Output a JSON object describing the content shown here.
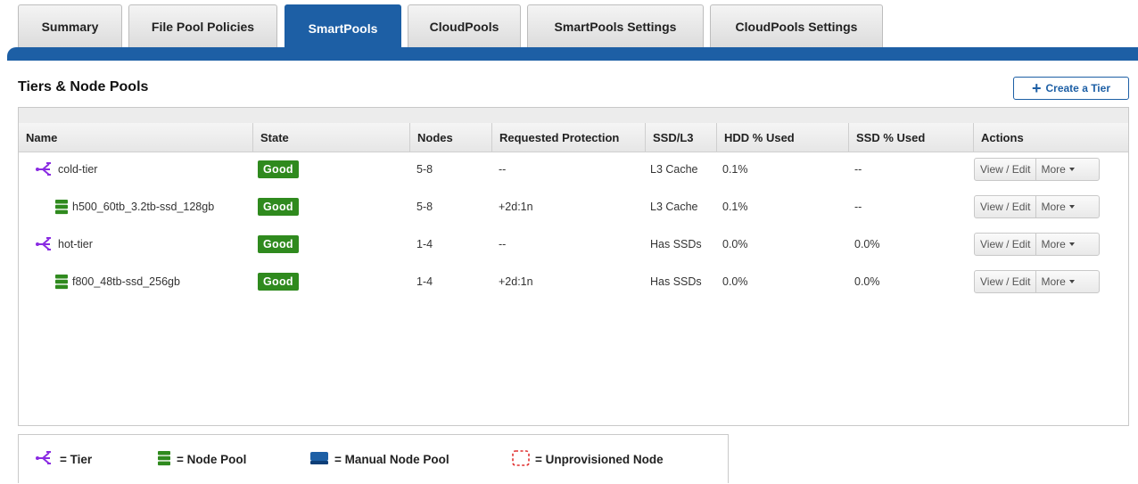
{
  "tabs": [
    {
      "label": "Summary",
      "active": false
    },
    {
      "label": "File Pool Policies",
      "active": false
    },
    {
      "label": "SmartPools",
      "active": true
    },
    {
      "label": "CloudPools",
      "active": false
    },
    {
      "label": "SmartPools Settings",
      "active": false
    },
    {
      "label": "CloudPools Settings",
      "active": false
    }
  ],
  "section": {
    "title": "Tiers & Node Pools",
    "create_button": "Create a Tier",
    "create_icon": "plus-icon"
  },
  "table": {
    "columns": [
      "Name",
      "State",
      "Nodes",
      "Requested Protection",
      "SSD/L3",
      "HDD % Used",
      "SSD % Used",
      "Actions"
    ],
    "rows": [
      {
        "type": "tier",
        "icon": "tier-icon",
        "name": "cold-tier",
        "state": "Good",
        "nodes": "5-8",
        "protection": "--",
        "ssd_l3": "L3 Cache",
        "hdd_used": "0.1%",
        "ssd_used": "--",
        "view_label": "View / Edit",
        "more_label": "More"
      },
      {
        "type": "node-pool",
        "icon": "node-pool-icon",
        "name": "h500_60tb_3.2tb-ssd_128gb",
        "state": "Good",
        "nodes": "5-8",
        "protection": "+2d:1n",
        "ssd_l3": "L3 Cache",
        "hdd_used": "0.1%",
        "ssd_used": "--",
        "view_label": "View / Edit",
        "more_label": "More"
      },
      {
        "type": "tier",
        "icon": "tier-icon",
        "name": "hot-tier",
        "state": "Good",
        "nodes": "1-4",
        "protection": "--",
        "ssd_l3": "Has SSDs",
        "hdd_used": "0.0%",
        "ssd_used": "0.0%",
        "view_label": "View / Edit",
        "more_label": "More"
      },
      {
        "type": "node-pool",
        "icon": "node-pool-icon",
        "name": "f800_48tb-ssd_256gb",
        "state": "Good",
        "nodes": "1-4",
        "protection": "+2d:1n",
        "ssd_l3": "Has SSDs",
        "hdd_used": "0.0%",
        "ssd_used": "0.0%",
        "view_label": "View / Edit",
        "more_label": "More"
      }
    ]
  },
  "legend": [
    {
      "icon": "tier-icon",
      "label": "= Tier"
    },
    {
      "icon": "node-pool-icon",
      "label": "= Node Pool"
    },
    {
      "icon": "manual-node-pool-icon",
      "label": "= Manual Node Pool"
    },
    {
      "icon": "unprovisioned-node-icon",
      "label": "= Unprovisioned Node"
    }
  ],
  "colors": {
    "accent": "#1d5fa5",
    "status_good": "#2f8a1e",
    "tier_icon": "#8a2be2",
    "node_pool_icon": "#2f8a1e",
    "unprovisioned": "#e03030"
  }
}
